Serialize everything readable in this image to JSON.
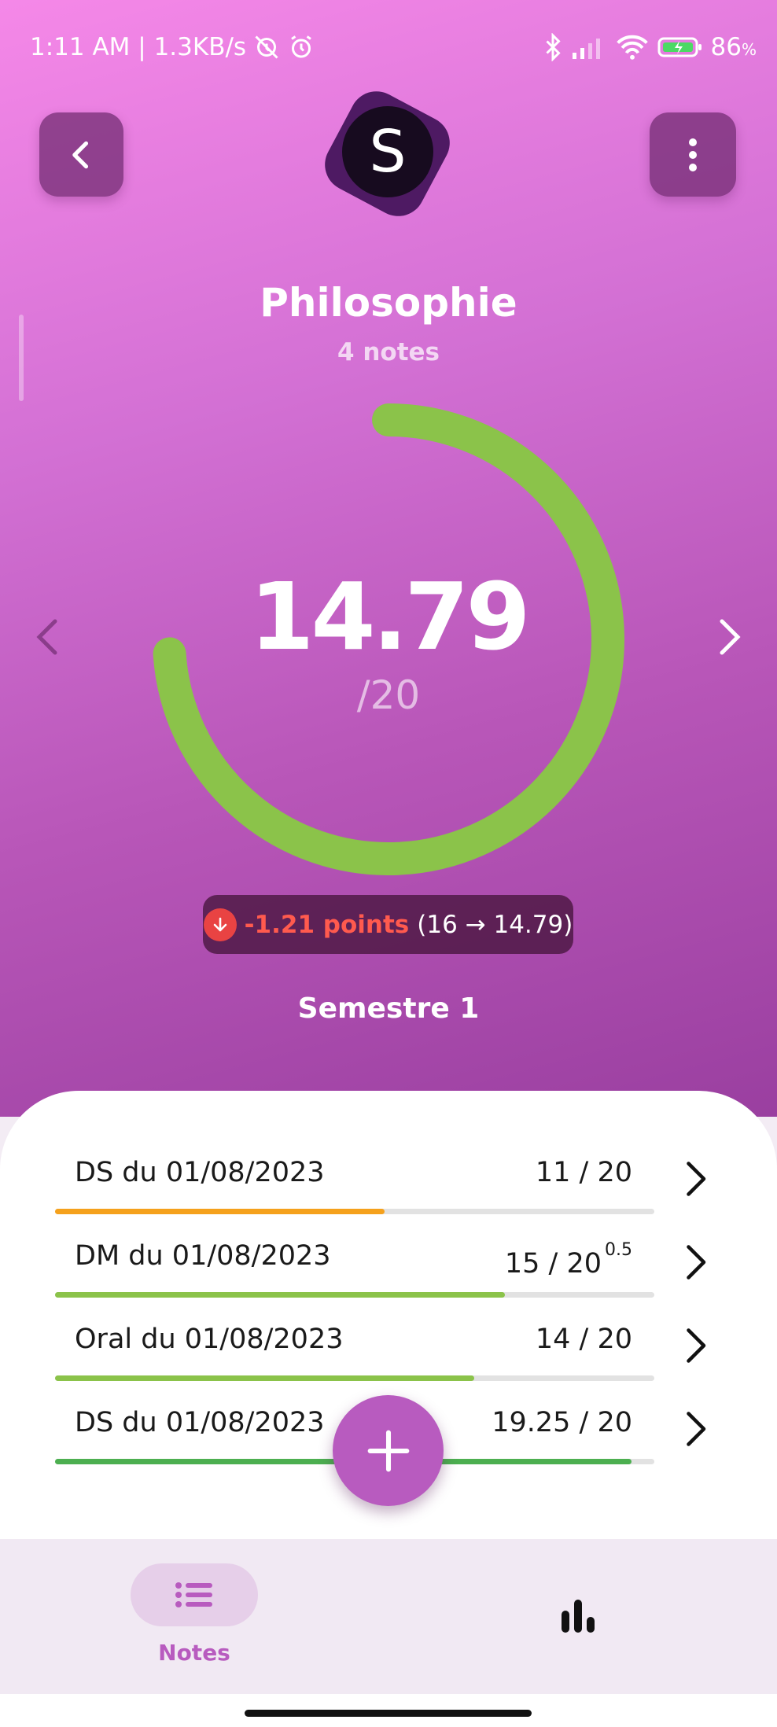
{
  "status_bar": {
    "time_speed": "1:11 AM | 1.3KB/s",
    "battery": "86",
    "battery_unit": "%"
  },
  "subject": {
    "logo_letter": "S",
    "name": "Philosophie",
    "notes_count": "4 notes",
    "average": "14.79",
    "max": "/20",
    "gauge_fraction": 0.7395,
    "change_points": "-1.21 points",
    "change_detail": "(16 → 14.79)",
    "period": "Semestre 1"
  },
  "grades": [
    {
      "label": "DS du 01/08/2023",
      "grade": "11 / 20",
      "coef": "",
      "fraction": 0.55,
      "color": "#f5a11c"
    },
    {
      "label": "DM du 01/08/2023",
      "grade": "15 / 20",
      "coef": "0.5",
      "fraction": 0.75,
      "color": "#8bc34a"
    },
    {
      "label": "Oral du 01/08/2023",
      "grade": "14 / 20",
      "coef": "",
      "fraction": 0.7,
      "color": "#8bc34a"
    },
    {
      "label": "DS du 01/08/2023",
      "grade": "19.25 / 20",
      "coef": "",
      "fraction": 0.9625,
      "color": "#4caf50"
    }
  ],
  "bottom_nav": {
    "notes_label": "Notes"
  },
  "colors": {
    "accent": "#b85bbf",
    "gauge": "#8bc34a",
    "negative": "#ff5a4e"
  },
  "icons": [
    "back-icon",
    "more-vert-icon",
    "chevron-left-icon",
    "chevron-right-icon",
    "arrow-down-icon",
    "plus-icon",
    "list-icon",
    "bar-chart-icon"
  ]
}
